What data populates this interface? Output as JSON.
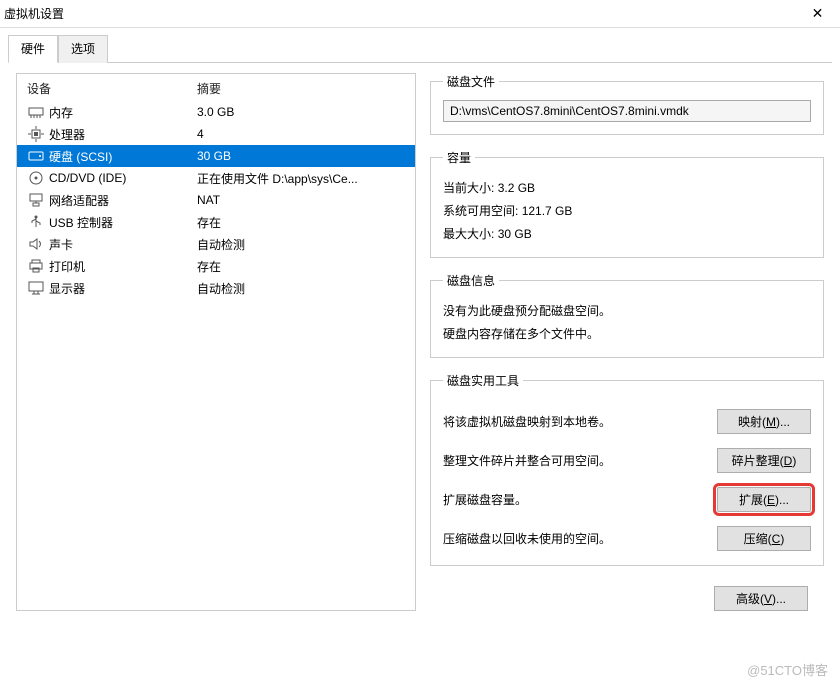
{
  "window": {
    "title": "虚拟机设置",
    "close_glyph": "✕"
  },
  "tabs": {
    "hardware": "硬件",
    "options": "选项"
  },
  "device_table": {
    "header_device": "设备",
    "header_summary": "摘要",
    "rows": [
      {
        "icon": "memory-icon",
        "name": "内存",
        "summary": "3.0 GB",
        "selected": false
      },
      {
        "icon": "cpu-icon",
        "name": "处理器",
        "summary": "4",
        "selected": false
      },
      {
        "icon": "disk-icon",
        "name": "硬盘 (SCSI)",
        "summary": "30 GB",
        "selected": true
      },
      {
        "icon": "cd-icon",
        "name": "CD/DVD (IDE)",
        "summary": "正在使用文件 D:\\app\\sys\\Ce...",
        "selected": false
      },
      {
        "icon": "network-icon",
        "name": "网络适配器",
        "summary": "NAT",
        "selected": false
      },
      {
        "icon": "usb-icon",
        "name": "USB 控制器",
        "summary": "存在",
        "selected": false
      },
      {
        "icon": "sound-icon",
        "name": "声卡",
        "summary": "自动检测",
        "selected": false
      },
      {
        "icon": "printer-icon",
        "name": "打印机",
        "summary": "存在",
        "selected": false
      },
      {
        "icon": "display-icon",
        "name": "显示器",
        "summary": "自动检测",
        "selected": false
      }
    ]
  },
  "disk_file": {
    "legend": "磁盘文件",
    "value": "D:\\vms\\CentOS7.8mini\\CentOS7.8mini.vmdk"
  },
  "capacity": {
    "legend": "容量",
    "current_label": "当前大小:",
    "current_value": "3.2 GB",
    "free_label": "系统可用空间:",
    "free_value": "121.7 GB",
    "max_label": "最大大小:",
    "max_value": "30 GB"
  },
  "disk_info": {
    "legend": "磁盘信息",
    "line1": "没有为此硬盘预分配磁盘空间。",
    "line2": "硬盘内容存储在多个文件中。"
  },
  "utilities": {
    "legend": "磁盘实用工具",
    "map_desc": "将该虚拟机磁盘映射到本地卷。",
    "map_btn": "映射(M)...",
    "defrag_desc": "整理文件碎片并整合可用空间。",
    "defrag_btn": "碎片整理(D)",
    "expand_desc": "扩展磁盘容量。",
    "expand_btn": "扩展(E)...",
    "compact_desc": "压缩磁盘以回收未使用的空间。",
    "compact_btn": "压缩(C)"
  },
  "advanced_btn": "高级(V)...",
  "watermark": "@51CTO博客"
}
